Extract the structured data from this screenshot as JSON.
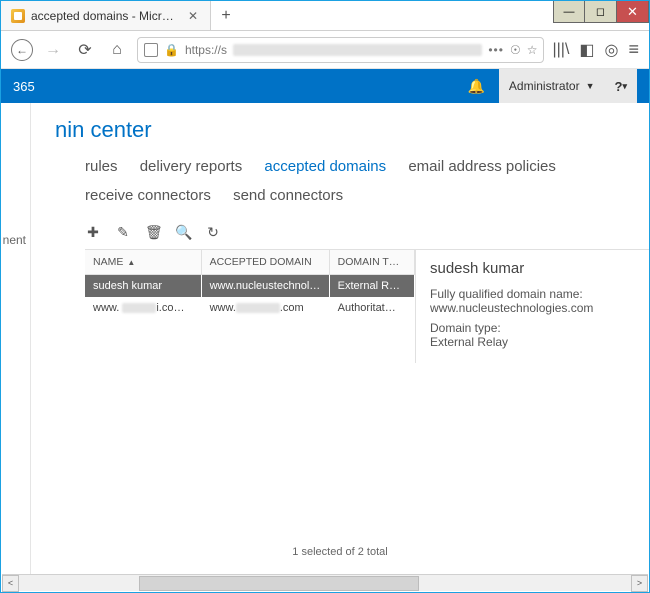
{
  "window": {
    "tab_title": "accepted domains - Microsoft …",
    "newtab_glyph": "+",
    "min_glyph": "—",
    "max_glyph": "◻",
    "close_glyph": "✕"
  },
  "urlbar": {
    "back": "←",
    "forward": "→",
    "reload": "⟳",
    "home": "⌂",
    "protocol": "https://s",
    "dots": "•••",
    "shield_tip": "Tracking protection",
    "lock_tip": "Secure connection",
    "reader": "☆",
    "download": "⬇",
    "library": "|||\\",
    "sidebar": "◧",
    "account": "◎",
    "menu": "≡"
  },
  "o365": {
    "product_fragment": "365",
    "bell": "🔔",
    "admin_label": "Administrator",
    "help_label": "?"
  },
  "page_title_fragment": "nin center",
  "left_fragment": "nent",
  "subnav": {
    "items": [
      "rules",
      "delivery reports",
      "accepted domains",
      "email address policies",
      "receive connectors",
      "send connectors"
    ],
    "active_index": 2
  },
  "toolbar": {
    "add": "✚",
    "edit": "✎",
    "delete": "🗑",
    "search": "🔍",
    "refresh": "↻"
  },
  "grid": {
    "columns": [
      "NAME",
      "ACCEPTED DOMAIN",
      "DOMAIN T…"
    ],
    "sort_col": 0,
    "rows": [
      {
        "name": "sudesh kumar",
        "domain": "www.nucleustechnologies.com",
        "type": "External R…",
        "selected": true,
        "blur_name": false,
        "blur_domain": false
      },
      {
        "name": "www. ████i.co…",
        "domain": "www.██████.com",
        "type": "Authoritat…",
        "selected": false,
        "blur_name": true,
        "blur_domain": true
      }
    ]
  },
  "details": {
    "title": "sudesh kumar",
    "fqdn_label": "Fully qualified domain name:",
    "fqdn_value": "www.nucleustechnologies.com",
    "type_label": "Domain type:",
    "type_value": "External Relay"
  },
  "footer": "1 selected of 2 total"
}
